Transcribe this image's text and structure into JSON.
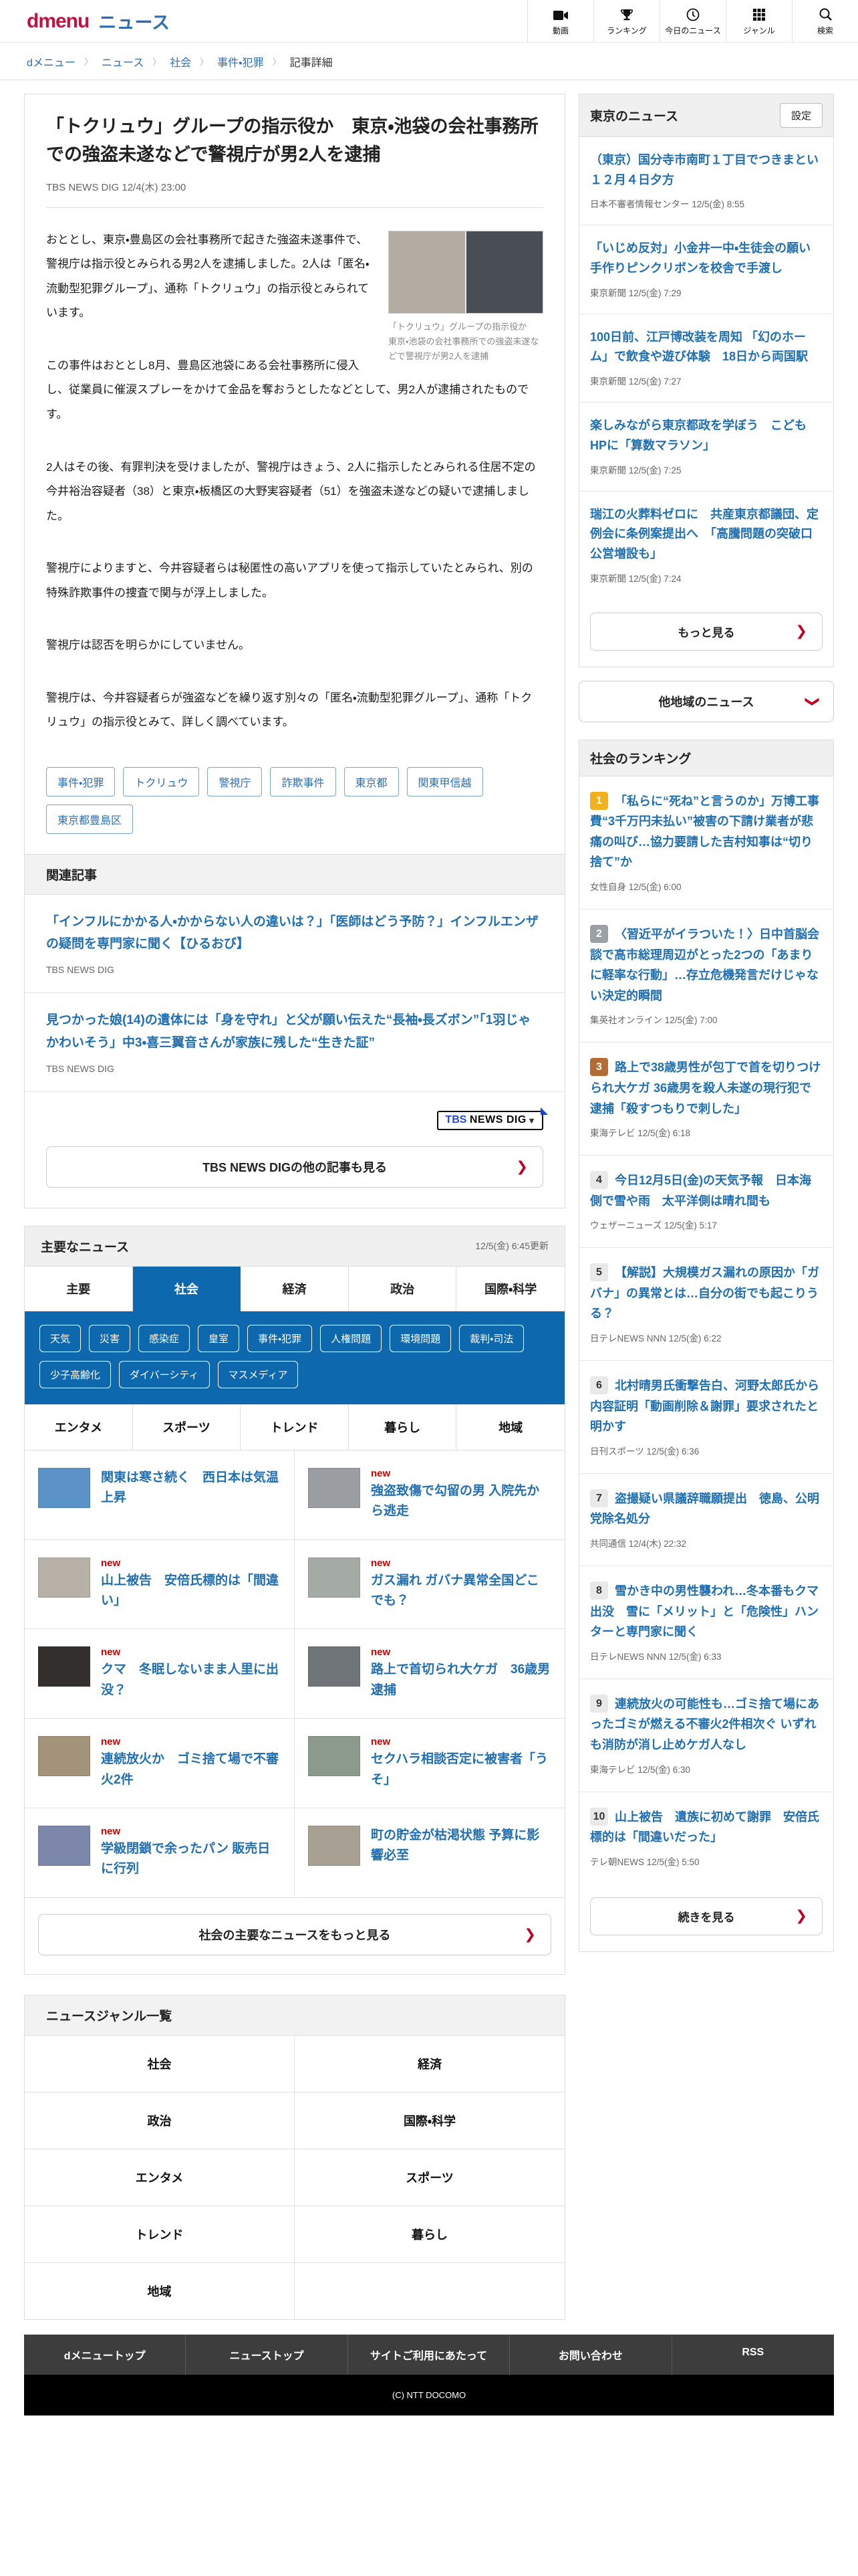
{
  "colors": {
    "brand_red": "#c11240",
    "brand_blue": "#2e6db4",
    "link_blue": "#1f6fb2",
    "active_tab_blue": "#0e68ad",
    "new_red": "#d00000",
    "chevron_red": "#c00021",
    "rank1_gold": "#f0b11d",
    "rank2_silver": "#9aa0a6",
    "rank3_bronze": "#b26c34",
    "rank_gray": "#e9e9e9"
  },
  "header": {
    "brand": "dmenu",
    "service": "ニュース",
    "nav": [
      {
        "label": "動画"
      },
      {
        "label": "ランキング"
      },
      {
        "label": "今日のニュース"
      },
      {
        "label": "ジャンル"
      },
      {
        "label": "検索"
      }
    ]
  },
  "breadcrumb": {
    "items": [
      {
        "label": "dメニュー",
        "chev": "〉"
      },
      {
        "label": "ニュース",
        "chev": "〉"
      },
      {
        "label": "社会",
        "chev": "〉"
      },
      {
        "label": "事件・犯罪",
        "chev": "〉"
      },
      {
        "label": "記事詳細",
        "cls": "current"
      }
    ]
  },
  "article": {
    "title": "「トクリュウ」グループの指示役か　東京・池袋の会社事務所での強盗未遂などで警視庁が男2人を逮捕",
    "source": "TBS NEWS DIG",
    "time": "12/4(木) 23:00",
    "photo_caption": "「トクリュウ」グループの指示役か　東京・池袋の会社事務所での強盗未遂などで警視庁が男2人を逮捕",
    "paragraphs": [
      "おととし、東京・豊島区の会社事務所で起きた強盗未遂事件で、警視庁は指示役とみられる男2人を逮捕しました。2人は「匿名・流動型犯罪グループ」、通称「トクリュウ」の指示役とみられています。",
      "この事件はおととし8月、豊島区池袋にある会社事務所に侵入し、従業員に催涙スプレーをかけて金品を奪おうとしたなどとして、男2人が逮捕されたものです。",
      "2人はその後、有罪判決を受けましたが、警視庁はきょう、2人に指示したとみられる住居不定の今井裕治容疑者（38）と東京・板橋区の大野実容疑者（51）を強盗未遂などの疑いで逮捕しました。",
      "警視庁によりますと、今井容疑者らは秘匿性の高いアプリを使って指示していたとみられ、別の特殊詐欺事件の捜査で関与が浮上しました。",
      "警視庁は認否を明らかにしていません。",
      "警視庁は、今井容疑者らが強盗などを繰り返す別々の「匿名・流動型犯罪グループ」、通称「トクリュウ」の指示役とみて、詳しく調べています。"
    ],
    "tags": [
      "事件・犯罪",
      "トクリュウ",
      "警視庁",
      "詐欺事件",
      "東京都",
      "関東甲信越",
      "東京都豊島区"
    ]
  },
  "related": {
    "heading": "関連記事",
    "items": [
      {
        "title": "「インフルにかかる人・かからない人の違いは？」「医師はどう予防？」インフルエンザの疑問を専門家に聞く【ひるおび】",
        "source": "TBS NEWS DIG"
      },
      {
        "title": "見つかった娘(14)の遺体には「身を守れ」と父が願い伝えた“長袖・長ズボン”「1羽じゃかわいそう」中3・喜三翼音さんが家族に残した“生きた証”",
        "source": "TBS NEWS DIG"
      }
    ],
    "logo": {
      "t1": "TBS",
      "t2": "NEWS DIG",
      "t3": "⩔"
    },
    "more_label": "TBS NEWS DIGの他の記事も見る"
  },
  "major": {
    "heading": "主要なニュース",
    "updated": "12/5(金) 6:45更新",
    "new_label": "new",
    "tabs": [
      {
        "label": "主要"
      },
      {
        "label": "社会",
        "cls": "active"
      },
      {
        "label": "経済"
      },
      {
        "label": "政治"
      },
      {
        "label": "国際・科学"
      }
    ],
    "topics": [
      "天気",
      "災害",
      "感染症",
      "皇室",
      "事件・犯罪",
      "人権問題",
      "環境問題",
      "裁判・司法",
      "少子高齢化",
      "ダイバーシティ",
      "マスメディア"
    ],
    "tabs2": [
      {
        "label": "エンタメ"
      },
      {
        "label": "スポーツ"
      },
      {
        "label": "トレンド"
      },
      {
        "label": "暮らし"
      },
      {
        "label": "地域"
      }
    ],
    "items": [
      {
        "title": "関東は寒さ続く　西日本は気温上昇",
        "is_new": false,
        "thumb": "#5b93c9"
      },
      {
        "title": "強盗致傷で勾留の男 入院先から逃走",
        "is_new": true,
        "thumb": "#9a9da1"
      },
      {
        "title": "山上被告　安倍氏標的は「間違い」",
        "is_new": true,
        "thumb": "#b7b0a6"
      },
      {
        "title": "ガス漏れ ガバナ異常全国どこでも？",
        "is_new": true,
        "thumb": "#a4aaa4"
      },
      {
        "title": "クマ　冬眠しないまま人里に出没？",
        "is_new": true,
        "thumb": "#332f2c"
      },
      {
        "title": "路上で首切られ大ケガ　36歳男逮捕",
        "is_new": true,
        "thumb": "#6e7477"
      },
      {
        "title": "連続放火か　ゴミ捨て場で不審火2件",
        "is_new": true,
        "thumb": "#a3937b"
      },
      {
        "title": "セクハラ相談否定に被害者「うそ」",
        "is_new": true,
        "thumb": "#8b9a8c"
      },
      {
        "title": "学級閉鎖で余ったパン 販売日に行列",
        "is_new": true,
        "thumb": "#7c87ab"
      },
      {
        "title": "町の貯金が枯渇状態 予算に影響必至",
        "is_new": false,
        "thumb": "#a8a193"
      }
    ],
    "more_label": "社会の主要なニュースをもっと見る"
  },
  "genres": {
    "heading": "ニュースジャンル一覧",
    "rows": [
      {
        "l": "社会",
        "r": "経済"
      },
      {
        "l": "政治",
        "r": "国際・科学"
      },
      {
        "l": "エンタメ",
        "r": "スポーツ"
      },
      {
        "l": "トレンド",
        "r": "暮らし"
      },
      {
        "l": "地域",
        "r": ""
      }
    ]
  },
  "sidebar": {
    "tokyo": {
      "heading": "東京のニュース",
      "settings_label": "設定",
      "items": [
        {
          "title": "（東京）国分寺市南町１丁目でつきまとい　１２月４日夕方",
          "source": "日本不審者情報センター",
          "time": "12/5(金) 8:55"
        },
        {
          "title": "「いじめ反対」小金井一中・生徒会の願い　手作りピンクリボンを校舎で手渡し",
          "source": "東京新聞",
          "time": "12/5(金) 7:29"
        },
        {
          "title": "100日前、江戸博改装を周知 「幻のホーム」で飲食や遊び体験　18日から両国駅",
          "source": "東京新聞",
          "time": "12/5(金) 7:27"
        },
        {
          "title": "楽しみながら東京都政を学ぼう　こどもHPに「算数マラソン」",
          "source": "東京新聞",
          "time": "12/5(金) 7:25"
        },
        {
          "title": "瑞江の火葬料ゼロに　共産東京都議団、定例会に条例案提出へ　「高騰問題の突破口　公営増設も」",
          "source": "東京新聞",
          "time": "12/5(金) 7:24"
        }
      ],
      "more_label": "もっと見る",
      "other_regions_label": "他地域のニュース"
    },
    "ranking": {
      "heading": "社会のランキング",
      "items": [
        {
          "rank": "1",
          "bg": "#f0b11d",
          "fg": "#fff",
          "title": "「私らに“死ね”と言うのか」万博工事費“3千万円未払い”被害の下請け業者が悲痛の叫び…協力要請した吉村知事は“切り捨て”か",
          "source": "女性自身",
          "time": "12/5(金) 6:00"
        },
        {
          "rank": "2",
          "bg": "#9aa0a6",
          "fg": "#fff",
          "title": "〈習近平がイラついた！〉日中首脳会談で高市総理周辺がとった2つの「あまりに軽率な行動」…存立危機発言だけじゃない決定的瞬間",
          "source": "集英社オンライン",
          "time": "12/5(金) 7:00"
        },
        {
          "rank": "3",
          "bg": "#b26c34",
          "fg": "#fff",
          "title": "路上で38歳男性が包丁で首を切りつけられ大ケガ 36歳男を殺人未遂の現行犯で逮捕「殺すつもりで刺した」",
          "source": "東海テレビ",
          "time": "12/5(金) 6:18"
        },
        {
          "rank": "4",
          "bg": "#e9e9e9",
          "fg": "#333",
          "title": "今日12月5日(金)の天気予報　日本海側で雪や雨　太平洋側は晴れ間も",
          "source": "ウェザーニューズ",
          "time": "12/5(金) 5:17"
        },
        {
          "rank": "5",
          "bg": "#e9e9e9",
          "fg": "#333",
          "title": "【解説】大規模ガス漏れの原因か「ガバナ」の異常とは…自分の街でも起こりうる？",
          "source": "日テレNEWS NNN",
          "time": "12/5(金) 6:22"
        },
        {
          "rank": "6",
          "bg": "#e9e9e9",
          "fg": "#333",
          "title": "北村晴男氏衝撃告白、河野太郎氏から内容証明「動画削除＆謝罪」要求されたと明かす",
          "source": "日刊スポーツ",
          "time": "12/5(金) 6:36"
        },
        {
          "rank": "7",
          "bg": "#e9e9e9",
          "fg": "#333",
          "title": "盗撮疑い県議辞職願提出　徳島、公明党除名処分",
          "source": "共同通信",
          "time": "12/4(木) 22:32"
        },
        {
          "rank": "8",
          "bg": "#e9e9e9",
          "fg": "#333",
          "title": "雪かき中の男性襲われ…冬本番もクマ出没　雪に「メリット」と「危険性」ハンターと専門家に聞く",
          "source": "日テレNEWS NNN",
          "time": "12/5(金) 6:33"
        },
        {
          "rank": "9",
          "bg": "#e9e9e9",
          "fg": "#333",
          "title": "連続放火の可能性も…ゴミ捨て場にあったゴミが燃える不審火2件相次ぐ いずれも消防が消し止めケガ人なし",
          "source": "東海テレビ",
          "time": "12/5(金) 6:30"
        },
        {
          "rank": "10",
          "bg": "#e9e9e9",
          "fg": "#333",
          "title": "山上被告　遺族に初めて謝罪　安倍氏標的は「間違いだった」",
          "source": "テレ朝NEWS",
          "time": "12/5(金) 5:50"
        }
      ],
      "more_label": "続きを見る"
    }
  },
  "footer": {
    "links": [
      "dメニュートップ",
      "ニューストップ",
      "サイトご利用にあたって",
      "お問い合わせ",
      "RSS"
    ],
    "copyright": "(C) NTT DOCOMO"
  }
}
